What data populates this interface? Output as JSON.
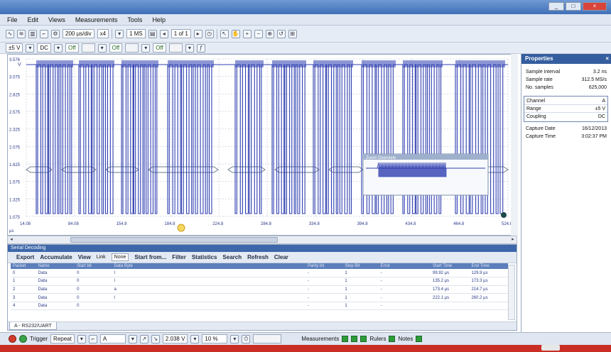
{
  "menu": [
    "File",
    "Edit",
    "Views",
    "Measurements",
    "Tools",
    "Help"
  ],
  "toolbar": {
    "timebase": "200 µs/div",
    "zoom": "x4",
    "samples": "1 MS",
    "capture_of": "1 of 1"
  },
  "channels": {
    "a_range": "±5 V",
    "a_coupling": "DC",
    "b_label": "Off",
    "c_label": "Off",
    "d_label": "Off"
  },
  "scope": {
    "y_unit": "V",
    "y_ticks": [
      "3.576",
      "3.075",
      "2.825",
      "2.575",
      "2.325",
      "2.075",
      "1.825",
      "1.575",
      "1.325",
      "1.075"
    ],
    "x_ticks": [
      "14.08",
      "84.08",
      "154.8",
      "184.8",
      "224.8",
      "284.8",
      "334.8",
      "394.8",
      "434.8",
      "464.8",
      "524.8"
    ],
    "x_unit": "µs",
    "overview_title": "Zoom Overview"
  },
  "properties": {
    "title": "Properties",
    "close": "×",
    "top": [
      {
        "k": "Sample interval",
        "v": "3.2 ns"
      },
      {
        "k": "Sample rate",
        "v": "312.5 MS/s"
      },
      {
        "k": "No. samples",
        "v": "625,000"
      }
    ],
    "channel": [
      {
        "k": "Channel",
        "v": "A"
      },
      {
        "k": "Range",
        "v": "±5 V"
      },
      {
        "k": "Coupling",
        "v": "DC"
      }
    ],
    "capture": [
      {
        "k": "Capture Date",
        "v": "16/12/2013"
      },
      {
        "k": "Capture Time",
        "v": "3:02:37 PM"
      }
    ]
  },
  "serial": {
    "header": "Serial Decoding",
    "buttons": {
      "export": "Export",
      "accumulate": "Accumulate",
      "view": "View",
      "link": "Link",
      "link_value": "None",
      "start_from": "Start from...",
      "filter": "Filter",
      "statistics": "Statistics",
      "search": "Search",
      "refresh": "Refresh",
      "clear": "Clear"
    },
    "columns": [
      "Packet",
      "Name",
      "Start bit",
      "Data Byte",
      "",
      "",
      "",
      "",
      "Parity bit",
      "Stop Bit",
      "Error",
      "Start Time",
      "End Time"
    ],
    "rows": [
      [
        "0",
        "Data",
        "0",
        "l",
        "-",
        "1",
        "-",
        "99.92 µs",
        "129.9 µs"
      ],
      [
        "1",
        "Data",
        "0",
        "l",
        "-",
        "1",
        "-",
        "135.2 µs",
        "173.3 µs"
      ],
      [
        "2",
        "Data",
        "0",
        "a",
        "-",
        "1",
        "-",
        "173.4 µs",
        "214.7 µs"
      ],
      [
        "3",
        "Data",
        "0",
        "l",
        "-",
        "1",
        "-",
        "222.1 µs",
        "260.2 µs"
      ],
      [
        "4",
        "Data",
        "0",
        "",
        "-",
        "1",
        "-",
        "",
        ""
      ]
    ],
    "tab": "A - RS232/UART"
  },
  "status": {
    "trigger": "Trigger",
    "trigger_mode": "Repeat",
    "trigger_channel": "A",
    "trigger_level": "2.038 V",
    "pre_trigger": "10 %",
    "measurements": "Measurements",
    "rulers": "Rulers",
    "notes": "Notes"
  },
  "colors": {
    "trace": "#2f3fb0",
    "bus": "#6b7a8c",
    "accent": "#3d67aa"
  }
}
